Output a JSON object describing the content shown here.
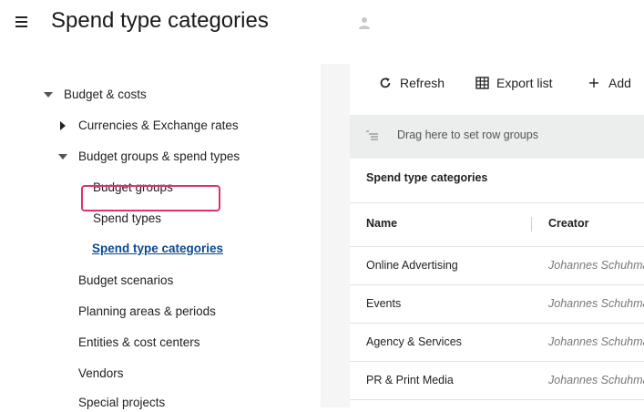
{
  "header": {
    "title": "Spend type categories",
    "menu_icon": "hamburger-menu-icon",
    "user_icon": "user-icon"
  },
  "sidebar": {
    "items": [
      {
        "label": "Budget & costs",
        "state": "expanded"
      },
      {
        "label": "Currencies & Exchange rates",
        "state": "collapsed"
      },
      {
        "label": "Budget groups & spend types",
        "state": "expanded"
      },
      {
        "label": "Budget groups"
      },
      {
        "label": "Spend types"
      },
      {
        "label": "Spend type categories",
        "selected": true
      },
      {
        "label": "Budget scenarios"
      },
      {
        "label": "Planning areas & periods"
      },
      {
        "label": "Entities & cost centers"
      },
      {
        "label": "Vendors"
      },
      {
        "label": "Special projects"
      }
    ]
  },
  "toolbar": {
    "refresh_label": "Refresh",
    "export_label": "Export list",
    "add_label": "Add"
  },
  "group_bar": {
    "text": "Drag here to set row groups"
  },
  "grid": {
    "title": "Spend type categories",
    "columns": [
      "Name",
      "Creator"
    ],
    "rows": [
      {
        "name": "Online Advertising",
        "creator": "Johannes Schuhmann"
      },
      {
        "name": "Events",
        "creator": "Johannes Schuhmann"
      },
      {
        "name": "Agency & Services",
        "creator": "Johannes Schuhmann"
      },
      {
        "name": "PR & Print Media",
        "creator": "Johannes Schuhmann"
      }
    ]
  },
  "colors": {
    "selection_border": "#e0336a",
    "selected_link": "#0b4a8f",
    "group_bar_bg": "#eceded"
  }
}
